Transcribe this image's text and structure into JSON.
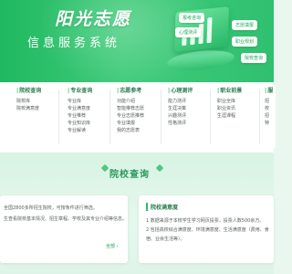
{
  "banner": {
    "title": "阳光志愿",
    "subtitle": "信息服务系统",
    "bubbles": [
      "报考咨询",
      "志愿填报",
      "心理测评",
      "职业规划",
      "院校查询"
    ]
  },
  "categories": [
    {
      "title": "院校查询",
      "items": [
        "院校库",
        "院校满意度"
      ]
    },
    {
      "title": "专业查询",
      "items": [
        "专业库",
        "专业满意度",
        "专业推荐",
        "专业知识库",
        "专业解读"
      ]
    },
    {
      "title": "志愿参考",
      "items": [
        "功能介绍",
        "智能推荐志愿",
        "专业志愿推荐",
        "专业填报",
        "我的志愿表"
      ]
    },
    {
      "title": "心理测评",
      "items": [
        "能力测评",
        "生涯决策",
        "兴趣测评",
        "性格测评"
      ]
    },
    {
      "title": "职业前景",
      "items": [
        "职业全库",
        "职业资讯",
        "生涯课程"
      ]
    },
    {
      "title": "服",
      "items": [
        "招",
        "校",
        "招",
        "特"
      ]
    }
  ],
  "section": {
    "title": "院校查询"
  },
  "left_panel": {
    "lines": [
      "全国2800多所招生院校，可按条件进行筛选。",
      "生查看院校基本情况、招生章程、学校及其专业介绍等信息。"
    ],
    "more": "全部 ›"
  },
  "right_panel": {
    "tag": "院校满意度",
    "lines": [
      "1  数据来源于本校学生学习网页投票，投票人数500余万。",
      "2  包括高校综合满意度、环境满意度、生活满意度（费用、食",
      "   宿、业余生活等）。"
    ]
  },
  "colors": {
    "brand": "#20b861",
    "accent": "#30b96a",
    "title_text": "#2a7a4d"
  }
}
